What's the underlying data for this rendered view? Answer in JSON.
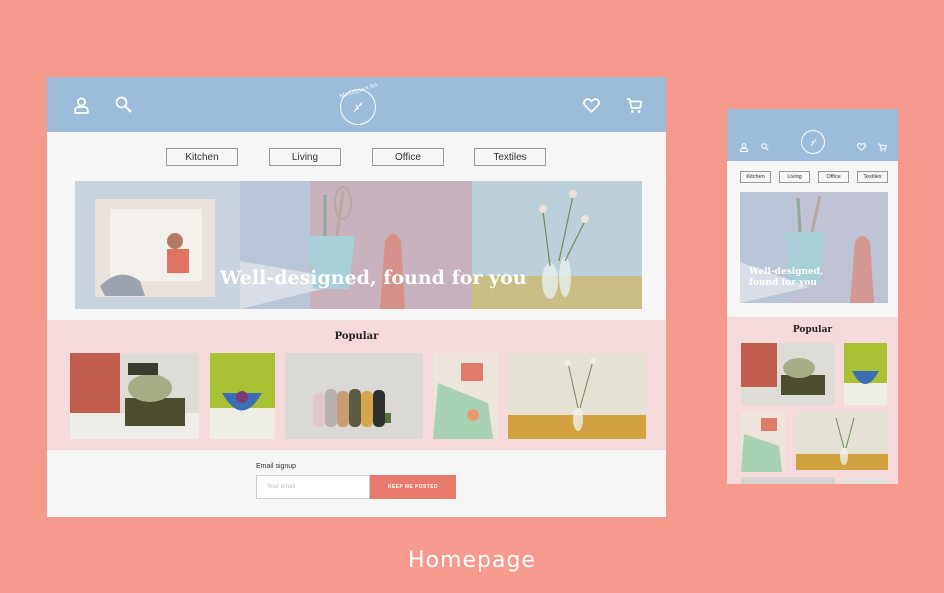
{
  "brand": {
    "logo_text": "Marketplace Art",
    "logo_icon": "wheat-sprig-icon"
  },
  "desktop": {
    "header": {
      "left_icons": [
        "user-icon",
        "search-icon"
      ],
      "right_icons": [
        "heart-icon",
        "cart-icon"
      ]
    },
    "categories": [
      "Kitchen",
      "Living",
      "Office",
      "Textiles"
    ],
    "hero": {
      "title": "Well-designed, found for you"
    },
    "popular": {
      "title": "Popular"
    },
    "signup": {
      "label": "Email signup",
      "placeholder": "Your email",
      "button": "KEEP ME POSTED"
    }
  },
  "mobile": {
    "categories": [
      "Kitchen",
      "Living",
      "Office",
      "Textiles"
    ],
    "hero": {
      "title_line1": "Well-designed,",
      "title_line2": "found for you"
    },
    "popular": {
      "title": "Popular"
    }
  },
  "caption": "Homepage",
  "colors": {
    "background": "#F59A8D",
    "header": "#9DBCDA",
    "page": "#F7F6F6",
    "popular_band": "#F5DADB",
    "button": "#E8796B"
  }
}
